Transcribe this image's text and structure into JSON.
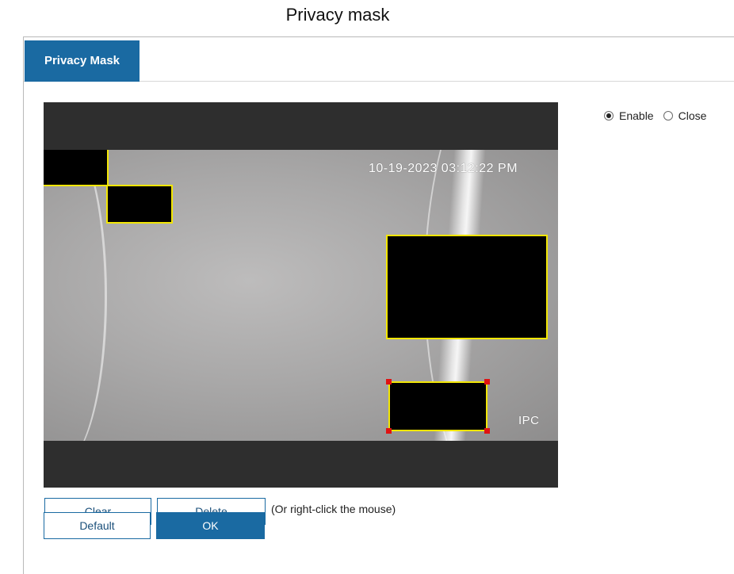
{
  "caption": "Privacy mask",
  "tabs": [
    {
      "label": "Privacy Mask",
      "active": true
    }
  ],
  "video": {
    "timestamp": "10-19-2023 03:12:22 PM",
    "camera_name": "IPC",
    "mask_count": 4,
    "selected_mask": 4,
    "mask_border_color": "#f2e600",
    "selected_handle_color": "#e01212"
  },
  "mode": {
    "options": [
      {
        "label": "Enable",
        "checked": true
      },
      {
        "label": "Close",
        "checked": false
      }
    ]
  },
  "buttons": {
    "clear": "Clear",
    "delete": "Delete",
    "default": "Default",
    "ok": "OK"
  },
  "hint": "(Or right-click the mouse)",
  "colors": {
    "accent": "#1a6aa2"
  }
}
